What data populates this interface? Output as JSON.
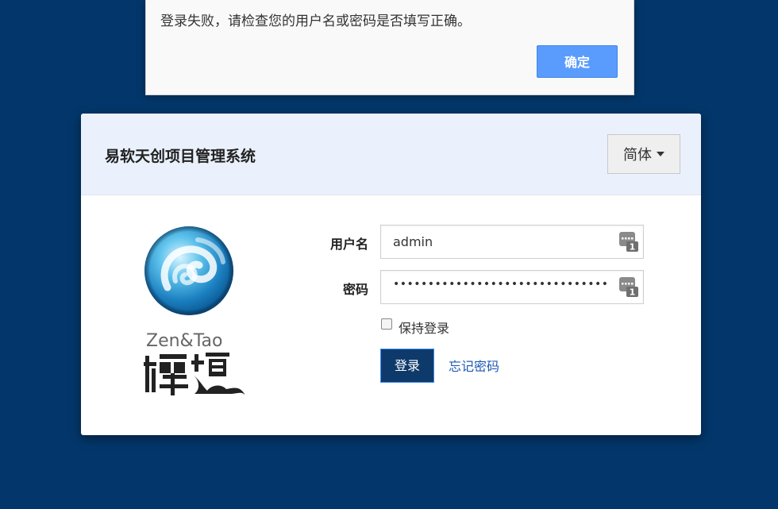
{
  "alert": {
    "message": "登录失败，请检查您的用户名或密码是否填写正确。",
    "ok_label": "确定"
  },
  "login": {
    "title": "易软天创项目管理系统",
    "language": "简体",
    "brand_en": "Zen&Tao",
    "brand_cn": "禪道",
    "username_label": "用户名",
    "username_value": "admin",
    "password_label": "密码",
    "password_mask": "•••••••••••••••••••••••••••••••",
    "keep_login_label": "保持登录",
    "login_button": "登录",
    "forgot_password": "忘记密码"
  },
  "colors": {
    "background": "#03376b",
    "header_bg": "#eaf1fc",
    "ok_button": "#5a9cfd",
    "login_button": "#0e3a6b",
    "link": "#1d59b4"
  },
  "icons": {
    "keyboard": "keyboard-badge-icon",
    "caret": "caret-down-icon",
    "logo": "zentao-orb-logo"
  }
}
